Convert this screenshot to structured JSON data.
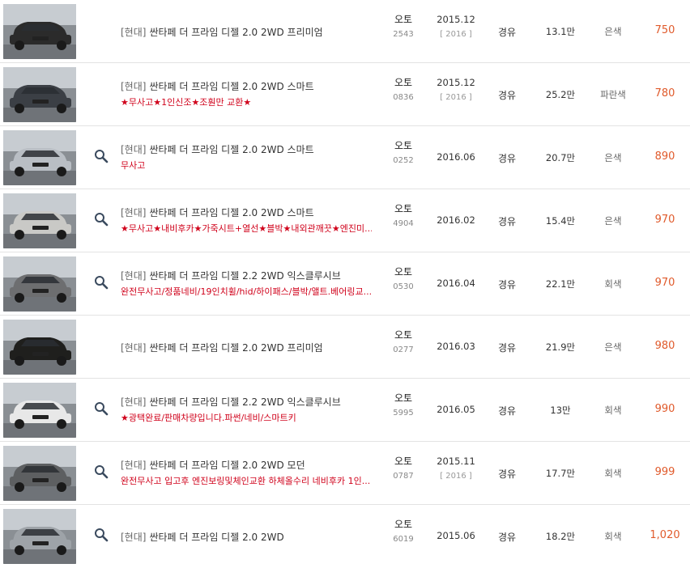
{
  "listing": {
    "rows": [
      {
        "maker": "[현대]",
        "title": "싼타페 더 프라임 디젤 2.0 2WD 프리미엄",
        "desc": "",
        "trans": "오토",
        "code": "2543",
        "year": "2015.12",
        "model_year": "[ 2016 ]",
        "fuel": "경유",
        "km": "13.1만",
        "color": "은색",
        "price": "750",
        "has_zoom": false,
        "car_color": "#2b2b2b"
      },
      {
        "maker": "[현대]",
        "title": "싼타페 더 프라임 디젤 2.0 2WD 스마트",
        "desc": "★무사고★1인신조★조훤만 교환★",
        "trans": "오토",
        "code": "0836",
        "year": "2015.12",
        "model_year": "[ 2016 ]",
        "fuel": "경유",
        "km": "25.2만",
        "color": "파란색",
        "price": "780",
        "has_zoom": false,
        "car_color": "#3b3f45"
      },
      {
        "maker": "[현대]",
        "title": "싼타페 더 프라임 디젤 2.0 2WD 스마트",
        "desc": "무사고",
        "trans": "오토",
        "code": "0252",
        "year": "2016.06",
        "model_year": "",
        "fuel": "경유",
        "km": "20.7만",
        "color": "은색",
        "price": "890",
        "has_zoom": true,
        "car_color": "#b9bec4"
      },
      {
        "maker": "[현대]",
        "title": "싼타페 더 프라임 디젤 2.0 2WD 스마트",
        "desc": "★무사고★내비후카★가죽시트+열선★블박★내외관깨끗★엔진미...",
        "trans": "오토",
        "code": "4904",
        "year": "2016.02",
        "model_year": "",
        "fuel": "경유",
        "km": "15.4만",
        "color": "은색",
        "price": "970",
        "has_zoom": true,
        "car_color": "#c9c9c6"
      },
      {
        "maker": "[현대]",
        "title": "싼타페 더 프라임 디젤 2.2 2WD 익스클루시브",
        "desc": "완전무사고/정품네비/19인치휠/hid/하이패스/블박/앨트.베어링교...",
        "trans": "오토",
        "code": "0530",
        "year": "2016.04",
        "model_year": "",
        "fuel": "경유",
        "km": "22.1만",
        "color": "회색",
        "price": "970",
        "has_zoom": true,
        "car_color": "#6d6e70"
      },
      {
        "maker": "[현대]",
        "title": "싼타페 더 프라임 디젤 2.0 2WD 프리미엄",
        "desc": "",
        "trans": "오토",
        "code": "0277",
        "year": "2016.03",
        "model_year": "",
        "fuel": "경유",
        "km": "21.9만",
        "color": "은색",
        "price": "980",
        "has_zoom": false,
        "car_color": "#1f1f1d"
      },
      {
        "maker": "[현대]",
        "title": "싼타페 더 프라임 디젤 2.2 2WD 익스클루시브",
        "desc": "★광택완료/판매차량입니다.파썬/네비/스마트키",
        "trans": "오토",
        "code": "5995",
        "year": "2016.05",
        "model_year": "",
        "fuel": "경유",
        "km": "13만",
        "color": "회색",
        "price": "990",
        "has_zoom": true,
        "car_color": "#e8e8e8"
      },
      {
        "maker": "[현대]",
        "title": "싼타페 더 프라임 디젤 2.0 2WD 모던",
        "desc": "완전무사고 입고후 엔진보링및체인교환 하체올수리 네비후카 1인...",
        "trans": "오토",
        "code": "0787",
        "year": "2015.11",
        "model_year": "[ 2016 ]",
        "fuel": "경유",
        "km": "17.7만",
        "color": "회색",
        "price": "999",
        "has_zoom": true,
        "car_color": "#5d5f61"
      },
      {
        "maker": "[현대]",
        "title": "싼타페 더 프라임 디젤 2.0 2WD",
        "desc": "",
        "trans": "오토",
        "code": "6019",
        "year": "2015.06",
        "model_year": "",
        "fuel": "경유",
        "km": "18.2만",
        "color": "회색",
        "price": "1,020",
        "has_zoom": true,
        "car_color": "#9ea3a8"
      }
    ]
  },
  "icons": {
    "zoom": "magnifier-icon"
  },
  "colors": {
    "price": "#e05a2b",
    "desc": "#d0021b",
    "divider": "#e3e3e3"
  }
}
